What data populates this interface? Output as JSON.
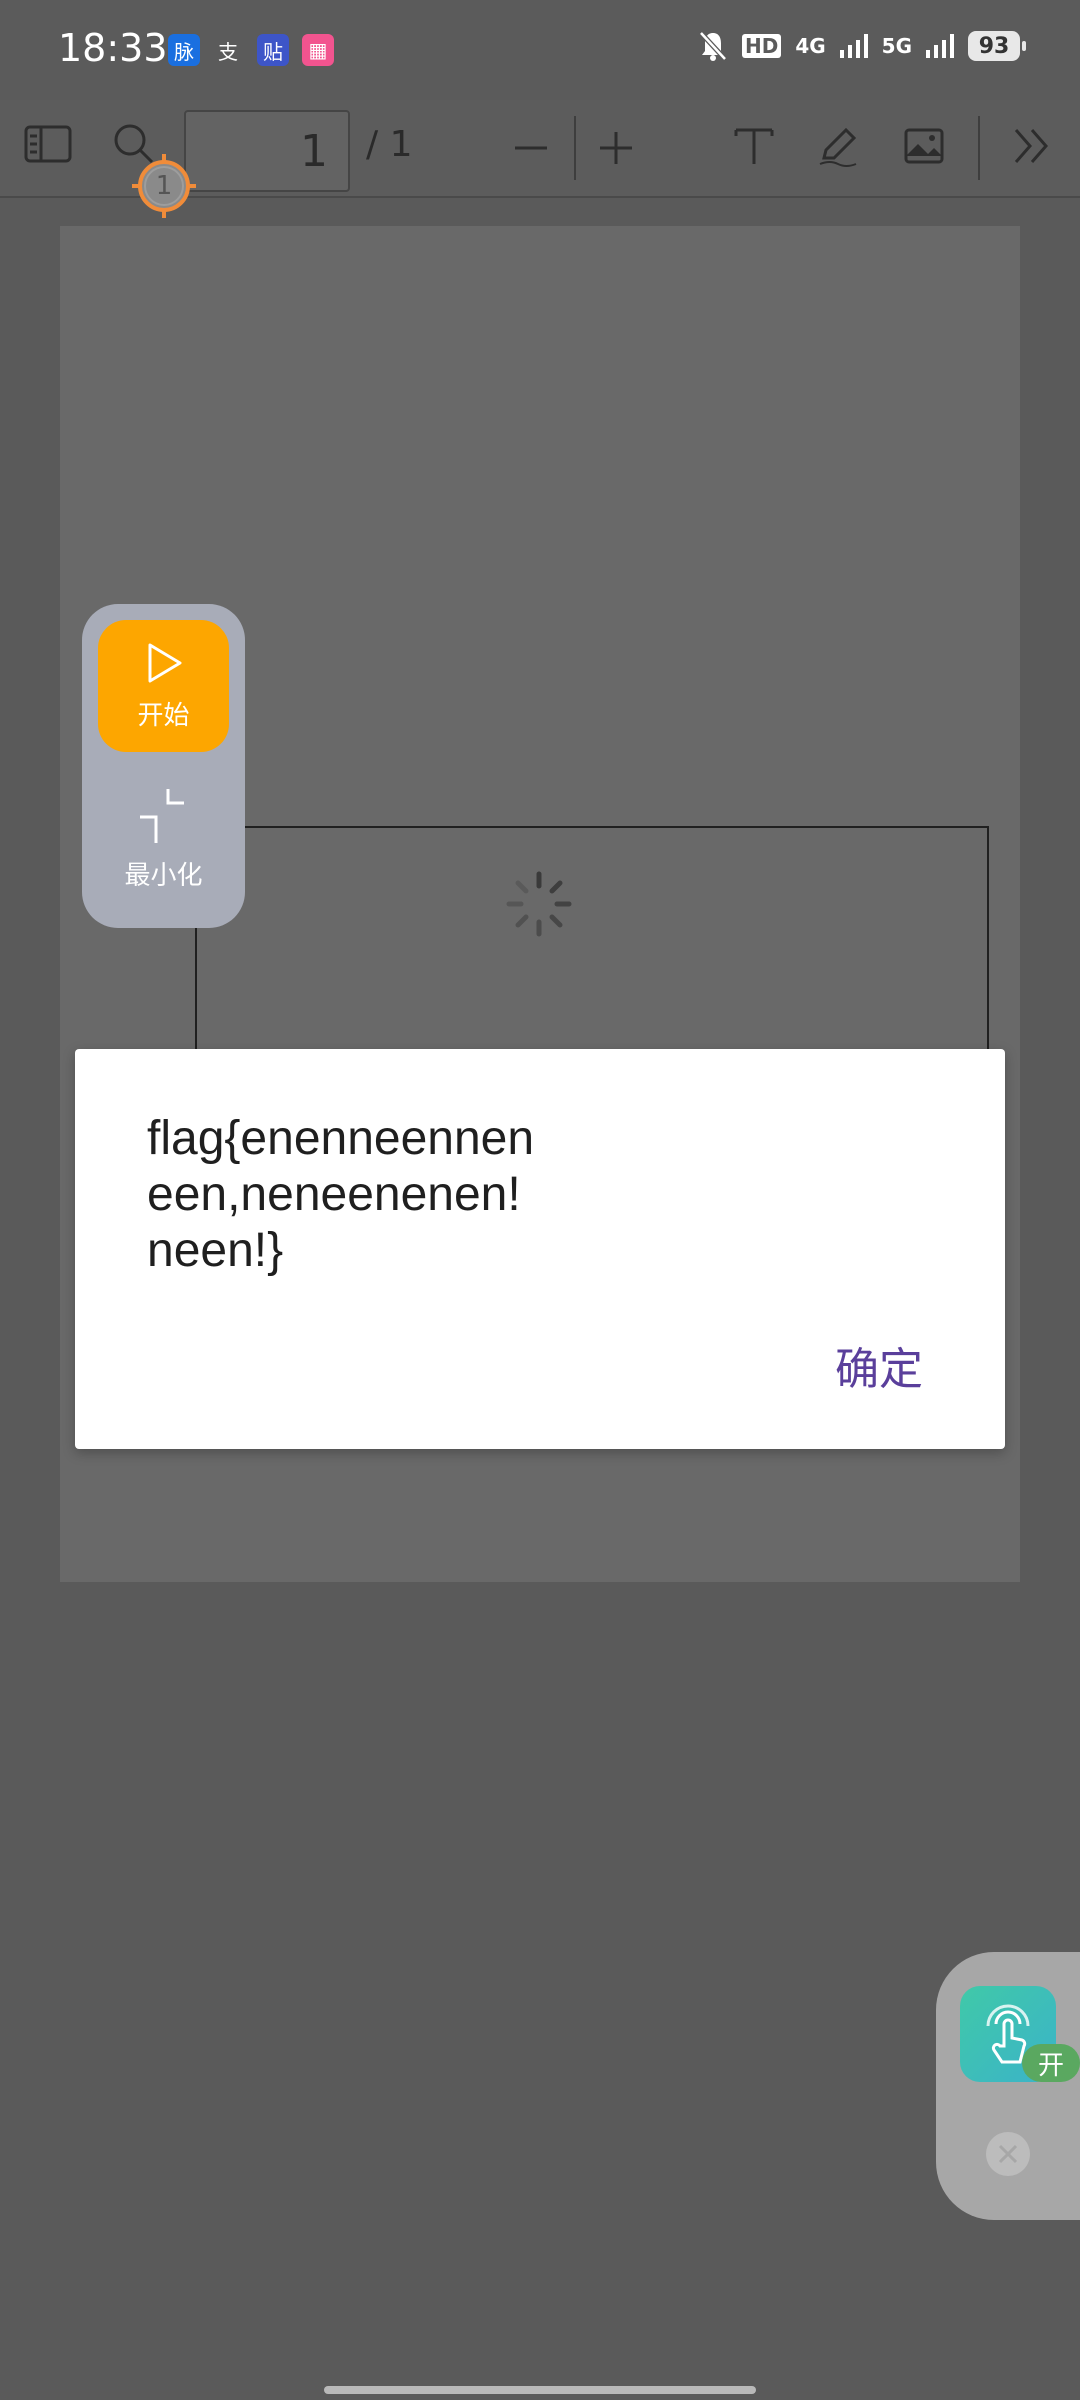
{
  "status_bar": {
    "time": "18:33",
    "notification_icons": [
      {
        "icon": "mai-app-icon",
        "glyph": "脉",
        "bg": "#1a6fe0"
      },
      {
        "icon": "zhi-app-icon",
        "glyph": "支",
        "bg": "transparent"
      },
      {
        "icon": "tie-app-icon",
        "glyph": "贴",
        "bg": "#3d55c8"
      },
      {
        "icon": "bili-app-icon",
        "glyph": "▦",
        "bg": "#f2548f"
      }
    ],
    "network_hd": "HD",
    "network_4g": "4G",
    "network_5g": "5G",
    "battery": "93"
  },
  "toolbar": {
    "page_current": "1",
    "page_total": "/ 1"
  },
  "annotation_marker": {
    "number": "1"
  },
  "floating_control": {
    "start_label": "开始",
    "minimize_label": "最小化"
  },
  "dialog": {
    "message": "flag{enenneennen een,neneenenen! neen!}",
    "confirm_label": "确定"
  },
  "assistant": {
    "badge": "开"
  },
  "colors": {
    "accent_orange": "#fda600",
    "dialog_button": "#5a3f9b",
    "assistant_green": "#40c9a8"
  }
}
